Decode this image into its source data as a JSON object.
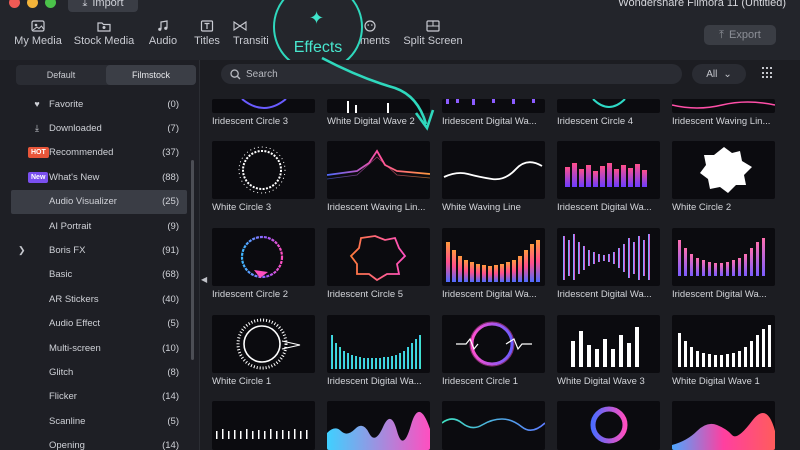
{
  "app": {
    "window_title": "Wondershare Filmora 11 (Untitled)",
    "import_label": "Import",
    "export_label": "Export"
  },
  "colors": {
    "accent": "#3ad9c1",
    "hot_badge": "#e8563a",
    "new_badge": "#7a4ff0"
  },
  "tabs": [
    {
      "label": "My Media",
      "icon": "media-icon"
    },
    {
      "label": "Stock Media",
      "icon": "stock-media-icon"
    },
    {
      "label": "Audio",
      "icon": "audio-icon"
    },
    {
      "label": "Titles",
      "icon": "titles-icon"
    },
    {
      "label": "Transiti",
      "icon": "transitions-icon"
    },
    {
      "label": "Effects",
      "icon": "sparkle-icon"
    },
    {
      "label": "ments",
      "icon": "elements-icon"
    },
    {
      "label": "Split Screen",
      "icon": "split-screen-icon"
    }
  ],
  "sidebar": {
    "segments": [
      "Default",
      "Filmstock"
    ],
    "items": [
      {
        "label": "Favorite",
        "count": "(0)",
        "icon": "heart-icon"
      },
      {
        "label": "Downloaded",
        "count": "(7)",
        "icon": "download-icon"
      },
      {
        "label": "Recommended",
        "count": "(37)",
        "badge": "HOT"
      },
      {
        "label": "What's New",
        "count": "(88)",
        "badge": "New"
      },
      {
        "label": "Audio Visualizer",
        "count": "(25)"
      },
      {
        "label": "AI Portrait",
        "count": "(9)"
      },
      {
        "label": "Boris FX",
        "count": "(91)"
      },
      {
        "label": "Basic",
        "count": "(68)"
      },
      {
        "label": "AR Stickers",
        "count": "(40)"
      },
      {
        "label": "Audio Effect",
        "count": "(5)"
      },
      {
        "label": "Multi-screen",
        "count": "(10)"
      },
      {
        "label": "Glitch",
        "count": "(8)"
      },
      {
        "label": "Flicker",
        "count": "(14)"
      },
      {
        "label": "Scanline",
        "count": "(5)"
      },
      {
        "label": "Opening",
        "count": "(14)"
      }
    ]
  },
  "toolbar": {
    "search_placeholder": "Search",
    "filter_value": "All"
  },
  "grid": {
    "rows": [
      [
        "Iridescent Circle 3",
        "White  Digital Wave 2",
        "Iridescent Digital Wa...",
        "Iridescent Circle 4",
        "Iridescent Waving Lin..."
      ],
      [
        "White Circle 3",
        "Iridescent Waving Lin...",
        "White Waving Line",
        "Iridescent Digital Wa...",
        "White Circle 2"
      ],
      [
        "Iridescent Circle 2",
        "Iridescent Circle 5",
        "Iridescent Digital Wa...",
        "Iridescent Digital Wa...",
        "Iridescent Digital Wa..."
      ],
      [
        "White Circle 1",
        "Iridescent Digital Wa...",
        "Iridescent Circle 1",
        "White Digital Wave 3",
        "White Digital Wave 1"
      ]
    ]
  }
}
